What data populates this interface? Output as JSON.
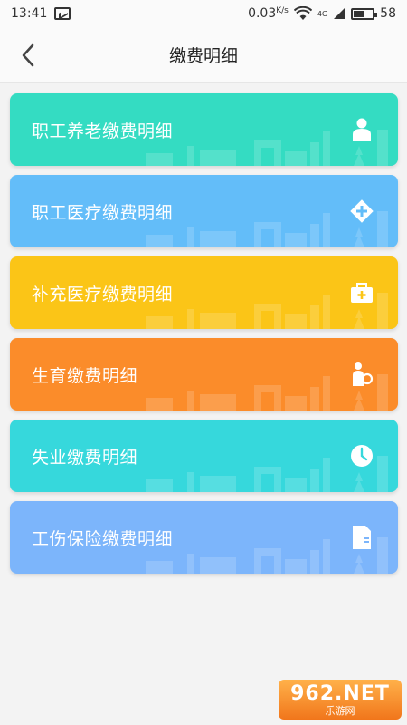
{
  "status_bar": {
    "time": "13:41",
    "speed": "0.03",
    "speed_unit": "K/s",
    "signal_type": "4G",
    "battery": "58",
    "battery_level": 0.58,
    "icons": [
      "message-icon",
      "wifi-icon",
      "signal-icon",
      "battery-icon"
    ]
  },
  "nav": {
    "title": "缴费明细",
    "back_icon": "chevron-left-icon"
  },
  "items": [
    {
      "label": "职工养老缴费明细",
      "icon": "elder-person-icon",
      "color": "#34dcc2"
    },
    {
      "label": "职工医疗缴费明细",
      "icon": "medical-cross-icon",
      "color": "#63bdf9"
    },
    {
      "label": "补充医疗缴费明细",
      "icon": "medical-kit-icon",
      "color": "#fbc517"
    },
    {
      "label": "生育缴费明细",
      "icon": "mother-baby-icon",
      "color": "#fb8c2a"
    },
    {
      "label": "失业缴费明细",
      "icon": "clock-icon",
      "color": "#36d8dc"
    },
    {
      "label": "工伤保险缴费明细",
      "icon": "document-icon",
      "color": "#7cb5fb"
    }
  ],
  "watermark": {
    "top": "962.NET",
    "bottom": "乐游网"
  }
}
